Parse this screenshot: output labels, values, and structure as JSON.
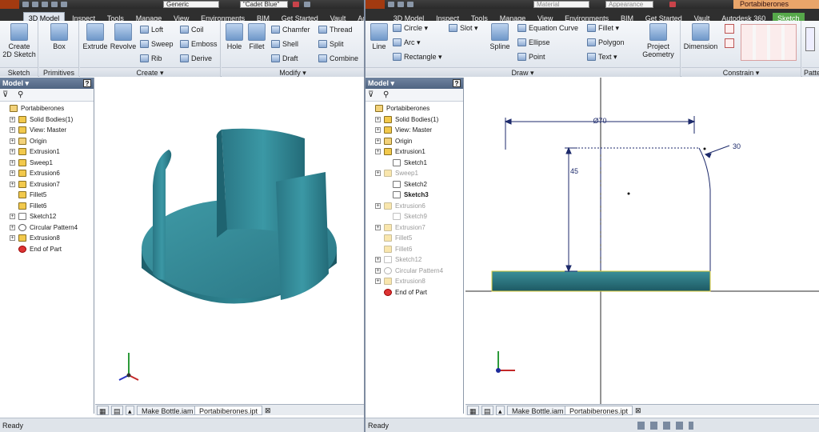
{
  "left": {
    "qat": {
      "material": "Generic",
      "appearance": "\"Cadet Blue\""
    },
    "tabs": [
      "3D Model",
      "Inspect",
      "Tools",
      "Manage",
      "View",
      "Environments",
      "BIM",
      "Get Started",
      "Vault",
      "Ad"
    ],
    "ribbon": {
      "sketch": {
        "label": "Sketch",
        "create_sketch": "Create\n2D Sketch"
      },
      "primitives": {
        "label": "Primitives",
        "box": "Box"
      },
      "create": {
        "label": "Create ▾",
        "extrude": "Extrude",
        "revolve": "Revolve",
        "loft": "Loft",
        "coil": "Coil",
        "sweep": "Sweep",
        "emboss": "Emboss",
        "rib": "Rib",
        "derive": "Derive"
      },
      "modify": {
        "label": "Modify ▾",
        "hole": "Hole",
        "fillet": "Fillet",
        "chamfer": "Chamfer",
        "thread": "Thread",
        "shell": "Shell",
        "split": "Split",
        "draft": "Draft",
        "combine": "Combine"
      }
    },
    "browser": {
      "title": "Model ▾",
      "help": "?",
      "items": [
        {
          "label": "Portabiberones",
          "level": 0,
          "icon": "part-icon",
          "exp": false
        },
        {
          "label": "Solid Bodies(1)",
          "level": 1,
          "icon": "solid-bodies-icon",
          "exp": true
        },
        {
          "label": "View: Master",
          "level": 1,
          "icon": "view-icon",
          "exp": true
        },
        {
          "label": "Origin",
          "level": 1,
          "icon": "folder-icon",
          "exp": true
        },
        {
          "label": "Extrusion1",
          "level": 1,
          "icon": "extrusion-icon",
          "exp": true
        },
        {
          "label": "Sweep1",
          "level": 1,
          "icon": "sweep-icon",
          "exp": true
        },
        {
          "label": "Extrusion6",
          "level": 1,
          "icon": "extrusion-icon",
          "exp": true
        },
        {
          "label": "Extrusion7",
          "level": 1,
          "icon": "extrusion-icon",
          "exp": true
        },
        {
          "label": "Fillet5",
          "level": 1,
          "icon": "fillet-icon",
          "exp": false
        },
        {
          "label": "Fillet6",
          "level": 1,
          "icon": "fillet-icon",
          "exp": false
        },
        {
          "label": "Sketch12",
          "level": 1,
          "icon": "sketch-icon",
          "exp": true
        },
        {
          "label": "Circular Pattern4",
          "level": 1,
          "icon": "pattern-icon",
          "exp": true
        },
        {
          "label": "Extrusion8",
          "level": 1,
          "icon": "extrusion-icon",
          "exp": true
        },
        {
          "label": "End of Part",
          "level": 1,
          "icon": "end-of-part-icon",
          "exp": false
        }
      ]
    },
    "doc_tabs": [
      "Make Bottle.iam",
      "Portabiberones.ipt"
    ],
    "status": "Ready",
    "colors": {
      "model": "#2e7f8c",
      "model_dark": "#1c5d69"
    }
  },
  "right": {
    "qat": {
      "material": "Material",
      "appearance": "Appearance",
      "doc_title": "Portabiberones"
    },
    "tabs": [
      "3D Model",
      "Inspect",
      "Tools",
      "Manage",
      "View",
      "Environments",
      "BIM",
      "Get Started",
      "Vault",
      "Autodesk 360",
      "Sketch"
    ],
    "ribbon": {
      "draw": {
        "label": "Draw ▾",
        "line": "Line",
        "circle": "Circle ▾",
        "slot": "Slot ▾",
        "spline": "Spline",
        "equation_curve": "Equation Curve",
        "fillet": "Fillet ▾",
        "arc": "Arc ▾",
        "ellipse": "Ellipse",
        "polygon": "Polygon",
        "rectangle": "Rectangle ▾",
        "point": "Point",
        "text": "Text ▾",
        "project_geometry": "Project\nGeometry"
      },
      "constrain": {
        "label": "Constrain ▾",
        "dimension": "Dimension"
      },
      "patt": {
        "label": "Patte"
      }
    },
    "browser": {
      "title": "Model ▾",
      "help": "?",
      "items": [
        {
          "label": "Portabiberones",
          "level": 0,
          "icon": "part-icon",
          "exp": false,
          "state": ""
        },
        {
          "label": "Solid Bodies(1)",
          "level": 1,
          "icon": "solid-bodies-icon",
          "exp": true,
          "state": ""
        },
        {
          "label": "View: Master",
          "level": 1,
          "icon": "view-icon",
          "exp": true,
          "state": ""
        },
        {
          "label": "Origin",
          "level": 1,
          "icon": "folder-icon",
          "exp": true,
          "state": ""
        },
        {
          "label": "Extrusion1",
          "level": 1,
          "icon": "extrusion-icon",
          "exp": true,
          "state": ""
        },
        {
          "label": "Sketch1",
          "level": 2,
          "icon": "sketch-icon",
          "exp": false,
          "state": ""
        },
        {
          "label": "Sweep1",
          "level": 1,
          "icon": "sweep-icon",
          "exp": true,
          "state": "dim"
        },
        {
          "label": "Sketch2",
          "level": 2,
          "icon": "sketch-icon",
          "exp": false,
          "state": ""
        },
        {
          "label": "Sketch3",
          "level": 2,
          "icon": "sketch-icon",
          "exp": false,
          "state": "bold"
        },
        {
          "label": "Extrusion6",
          "level": 1,
          "icon": "extrusion-icon",
          "exp": true,
          "state": "dim"
        },
        {
          "label": "Sketch9",
          "level": 2,
          "icon": "sketch-icon",
          "exp": false,
          "state": "dim"
        },
        {
          "label": "Extrusion7",
          "level": 1,
          "icon": "extrusion-icon",
          "exp": true,
          "state": "dim"
        },
        {
          "label": "Fillet5",
          "level": 1,
          "icon": "fillet-icon",
          "exp": false,
          "state": "dim"
        },
        {
          "label": "Fillet6",
          "level": 1,
          "icon": "fillet-icon",
          "exp": false,
          "state": "dim"
        },
        {
          "label": "Sketch12",
          "level": 1,
          "icon": "sketch-icon",
          "exp": true,
          "state": "dim"
        },
        {
          "label": "Circular Pattern4",
          "level": 1,
          "icon": "pattern-icon",
          "exp": true,
          "state": "dim"
        },
        {
          "label": "Extrusion8",
          "level": 1,
          "icon": "extrusion-icon",
          "exp": true,
          "state": "dim"
        },
        {
          "label": "End of Part",
          "level": 1,
          "icon": "end-of-part-icon",
          "exp": false,
          "state": ""
        }
      ]
    },
    "sketch": {
      "dim_width": "Ø70",
      "dim_height": "45",
      "dim_radius": "30"
    },
    "doc_tabs": [
      "Make Bottle.iam",
      "Portabiberones.ipt"
    ],
    "status": "Ready"
  }
}
